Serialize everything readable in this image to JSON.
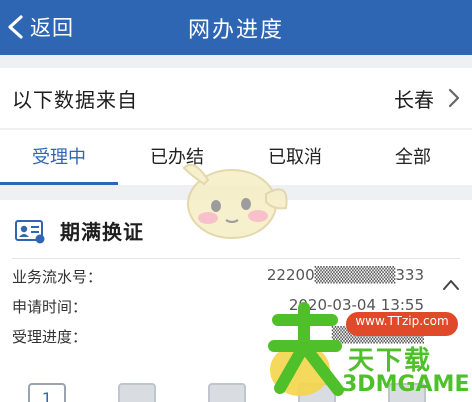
{
  "header": {
    "back_label": "返回",
    "title": "网办进度"
  },
  "source": {
    "label": "以下数据来自",
    "city": "长春"
  },
  "tabs": [
    {
      "label": "受理中",
      "active": true
    },
    {
      "label": "已办结",
      "active": false
    },
    {
      "label": "已取消",
      "active": false
    },
    {
      "label": "全部",
      "active": false
    }
  ],
  "card": {
    "icon": "id-card-icon",
    "title": "期满换证",
    "rows": [
      {
        "label": "业务流水号：",
        "value": "22200▒▒▒▒▒▒▒333"
      },
      {
        "label": "申请时间：",
        "value": "2020-03-04 13:55"
      },
      {
        "label": "受理进度：",
        "value": "▒▒▒▒▒▒▒▒"
      }
    ],
    "collapse_icon": "chevron-up-icon",
    "steps": [
      "1",
      "",
      "",
      "",
      ""
    ]
  },
  "watermark": {
    "url": "www.TTzip.com",
    "cn_text": "天下载",
    "brand": "3DMGAME"
  },
  "colors": {
    "primary": "#2f66b3",
    "background": "#eef0f3",
    "watermark_green": "#4fbf2a",
    "watermark_red": "#e0492a"
  }
}
